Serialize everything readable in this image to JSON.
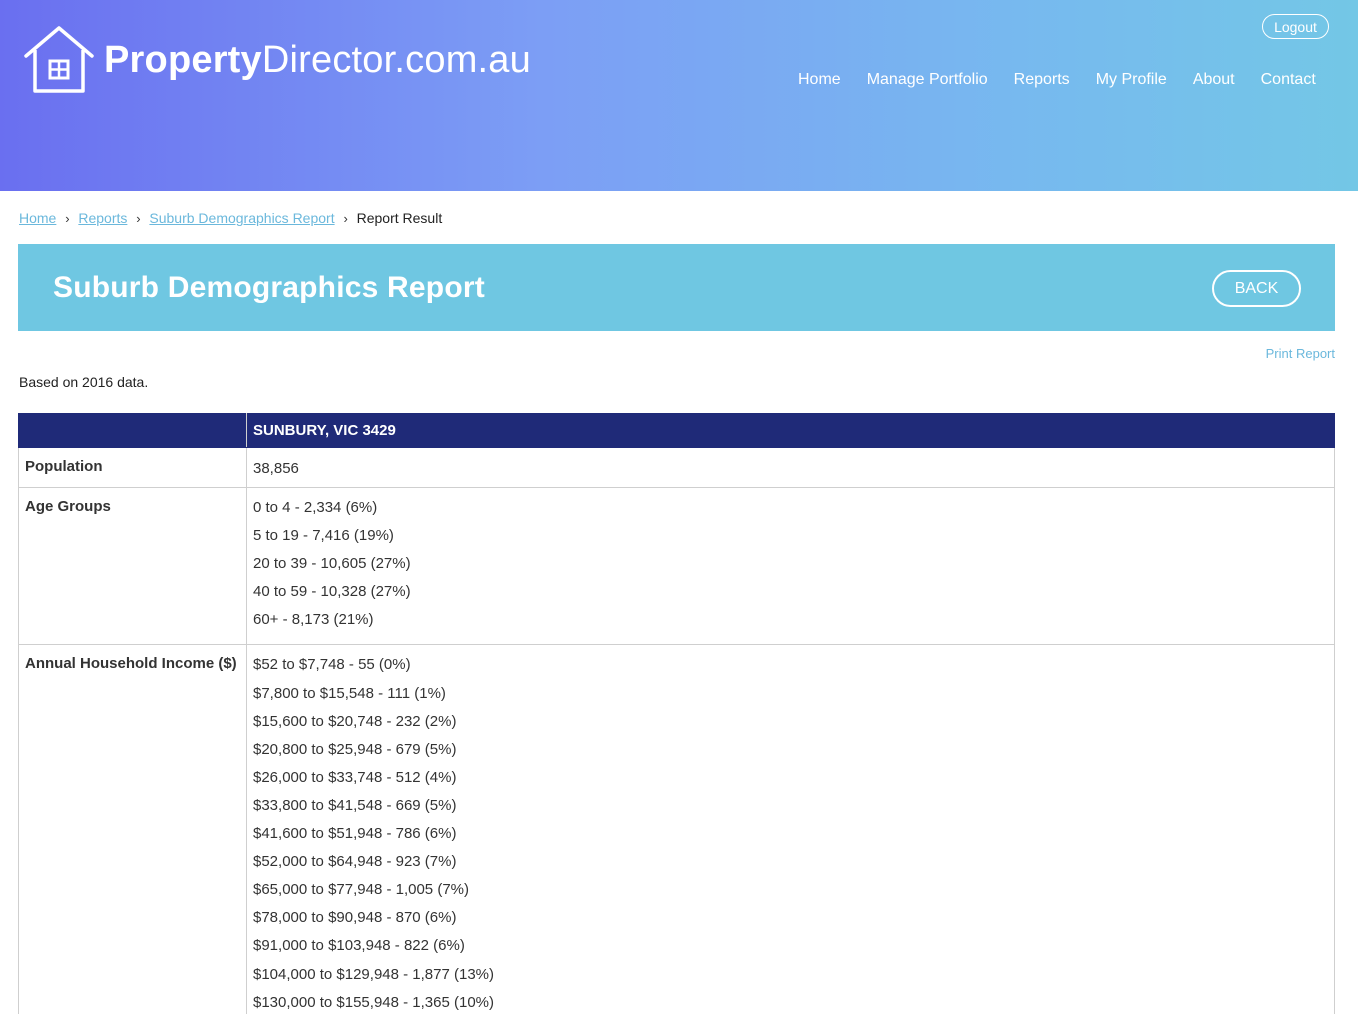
{
  "brand": {
    "bold": "Property",
    "thin": "Director.com.au"
  },
  "header": {
    "logout_label": "Logout",
    "nav": [
      "Home",
      "Manage Portfolio",
      "Reports",
      "My Profile",
      "About",
      "Contact"
    ]
  },
  "breadcrumb": {
    "items": [
      "Home",
      "Reports",
      "Suburb Demographics Report"
    ],
    "current": "Report Result"
  },
  "banner": {
    "title": "Suburb Demographics Report",
    "back_label": "BACK"
  },
  "print_label": "Print Report",
  "based_on": "Based on 2016 data.",
  "table": {
    "column_header": "SUNBURY, VIC 3429",
    "population": {
      "label": "Population",
      "value": "38,856"
    },
    "age_groups": {
      "label": "Age Groups",
      "values": [
        "0 to 4 - 2,334 (6%)",
        "5 to 19 - 7,416 (19%)",
        "20 to 39 - 10,605 (27%)",
        "40 to 59 - 10,328 (27%)",
        "60+ - 8,173 (21%)"
      ]
    },
    "income": {
      "label": "Annual Household Income ($)",
      "values": [
        "$52 to $7,748 - 55 (0%)",
        "$7,800 to $15,548 - 111 (1%)",
        "$15,600 to $20,748 - 232 (2%)",
        "$20,800 to $25,948 - 679 (5%)",
        "$26,000 to $33,748 - 512 (4%)",
        "$33,800 to $41,548 - 669 (5%)",
        "$41,600 to $51,948 - 786 (6%)",
        "$52,000 to $64,948 - 923 (7%)",
        "$65,000 to $77,948 - 1,005 (7%)",
        "$78,000 to $90,948 - 870 (6%)",
        "$91,000 to $103,948 - 822 (6%)",
        "$104,000 to $129,948 - 1,877 (13%)",
        "$130,000 to $155,948 - 1,365 (10%)"
      ]
    }
  }
}
